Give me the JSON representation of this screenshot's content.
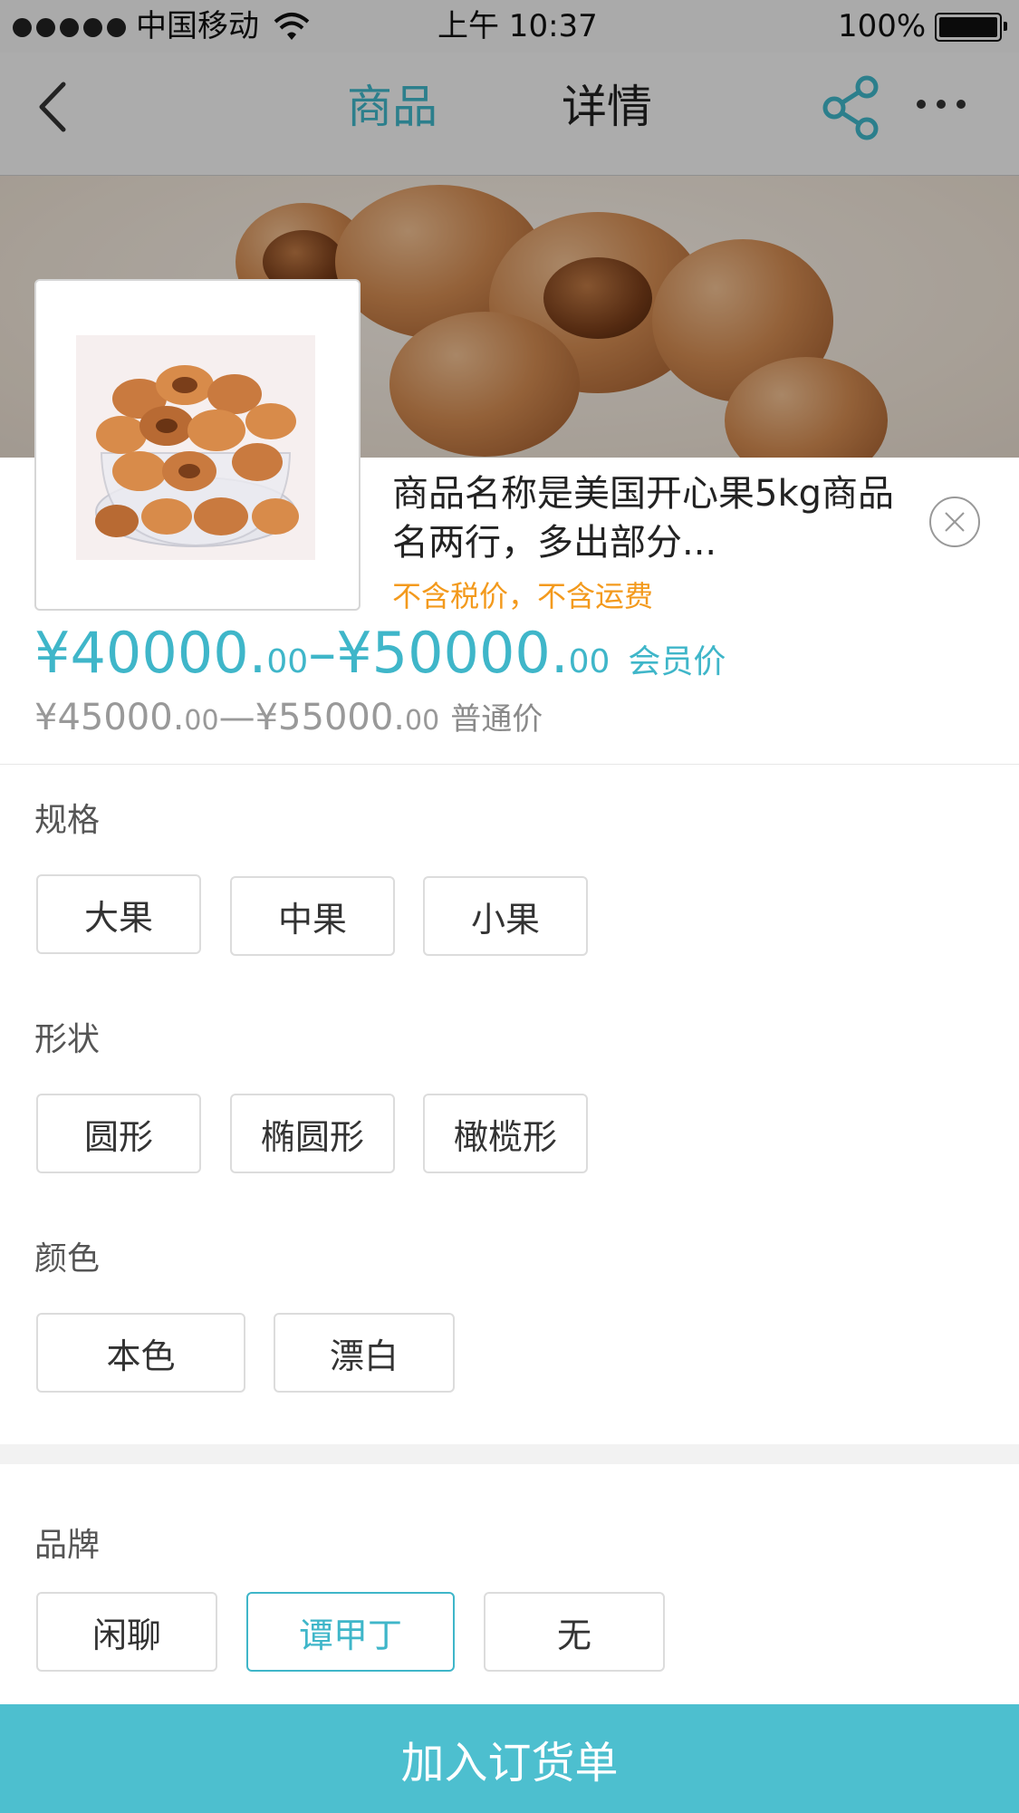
{
  "status_bar": {
    "carrier": "中国移动",
    "time": "上午 10:37",
    "battery": "100%"
  },
  "nav": {
    "tabs": [
      {
        "label": "商品",
        "active": true
      },
      {
        "label": "详情",
        "active": false
      }
    ]
  },
  "product": {
    "name": "商品名称是美国开心果5kg商品名两行，多出部分...",
    "tax_note": "不含税价，不含运费",
    "member_price": {
      "min_int": "¥40000.",
      "min_dec": "00",
      "sep": "–",
      "max_int": "¥50000.",
      "max_dec": "00",
      "label": "会员价"
    },
    "normal_price": {
      "min_int": "¥45000.",
      "min_dec": "00",
      "sep": "—",
      "max_int": "¥55000.",
      "max_dec": "00",
      "label": "普通价"
    }
  },
  "sections": {
    "spec": {
      "title": "规格",
      "options": [
        "大果",
        "中果",
        "小果"
      ]
    },
    "shape": {
      "title": "形状",
      "options": [
        "圆形",
        "椭圆形",
        "橄榄形"
      ]
    },
    "color": {
      "title": "颜色",
      "options": [
        "本色",
        "漂白"
      ]
    },
    "brand": {
      "title": "品牌",
      "options": [
        "闲聊",
        "谭甲丁",
        "无"
      ],
      "selected": "谭甲丁"
    }
  },
  "actions": {
    "add_to_order": "加入订货单"
  },
  "colors": {
    "accent": "#3fb6c9",
    "button_bg": "#4dbfcf",
    "note_orange": "#f39a1d"
  },
  "icons": [
    "back-icon",
    "share-icon",
    "more-icon",
    "close-icon",
    "wifi-icon",
    "battery-icon"
  ]
}
